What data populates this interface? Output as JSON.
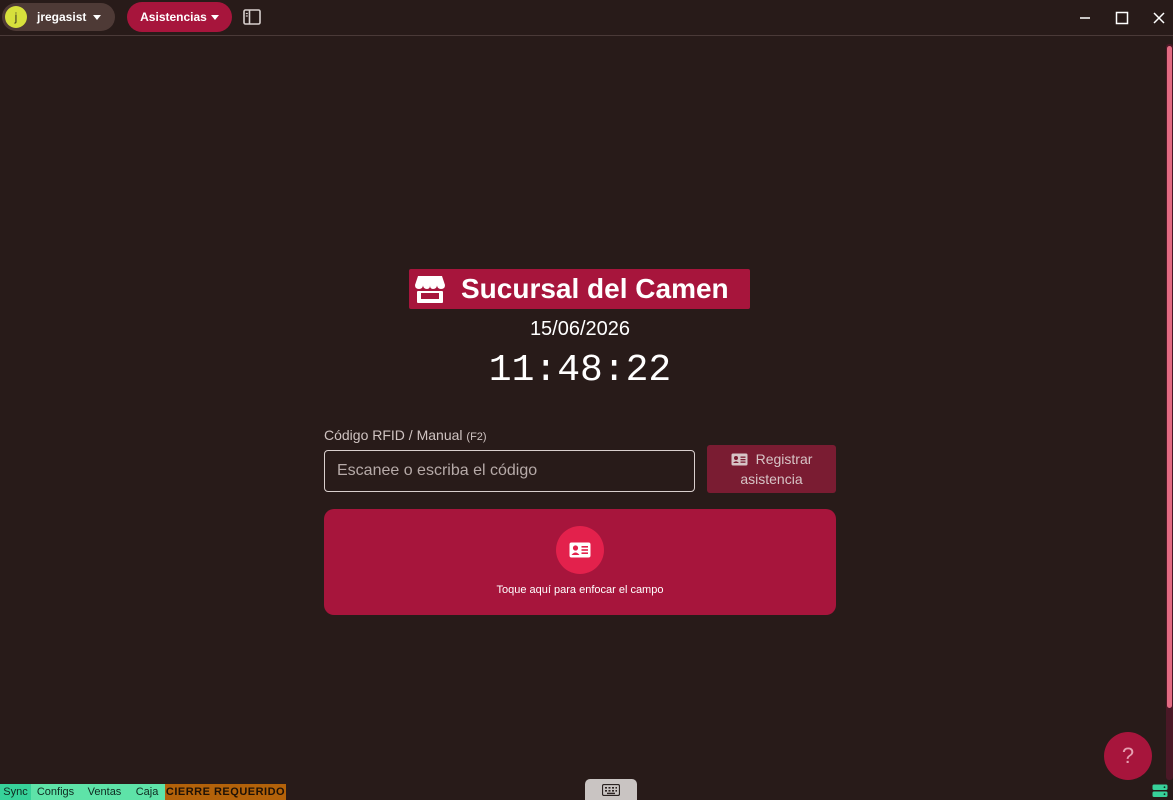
{
  "titlebar": {
    "user": {
      "initial": "j",
      "name": "jregasist"
    },
    "module": {
      "label": "Asistencias"
    },
    "icons": [
      "sidebar-toggle-icon",
      "minimize-icon",
      "maximize-icon",
      "close-icon"
    ]
  },
  "main": {
    "branch_name": "Sucursal del Camen",
    "date": "15/06/2026",
    "time": "11:48:22",
    "field_label": "Código RFID / Manual",
    "field_shortcut": "(F2)",
    "input_placeholder": "Escanee o escriba el código",
    "input_value": "",
    "register_label_line1": "Registrar",
    "register_label_line2": "asistencia",
    "focus_hint": "Toque aquí para enfocar el campo"
  },
  "help": {
    "label": "?"
  },
  "statusbar": {
    "sync": "Sync",
    "configs": "Configs",
    "ventas": "Ventas",
    "caja": "Caja",
    "cierre": "CIERRE REQUERIDO"
  },
  "colors": {
    "background": "#281b19",
    "accent": "#a7153c",
    "accent_bright": "#e3214c",
    "status_ok": "#5ee3a8",
    "status_warning": "#b3620a"
  }
}
